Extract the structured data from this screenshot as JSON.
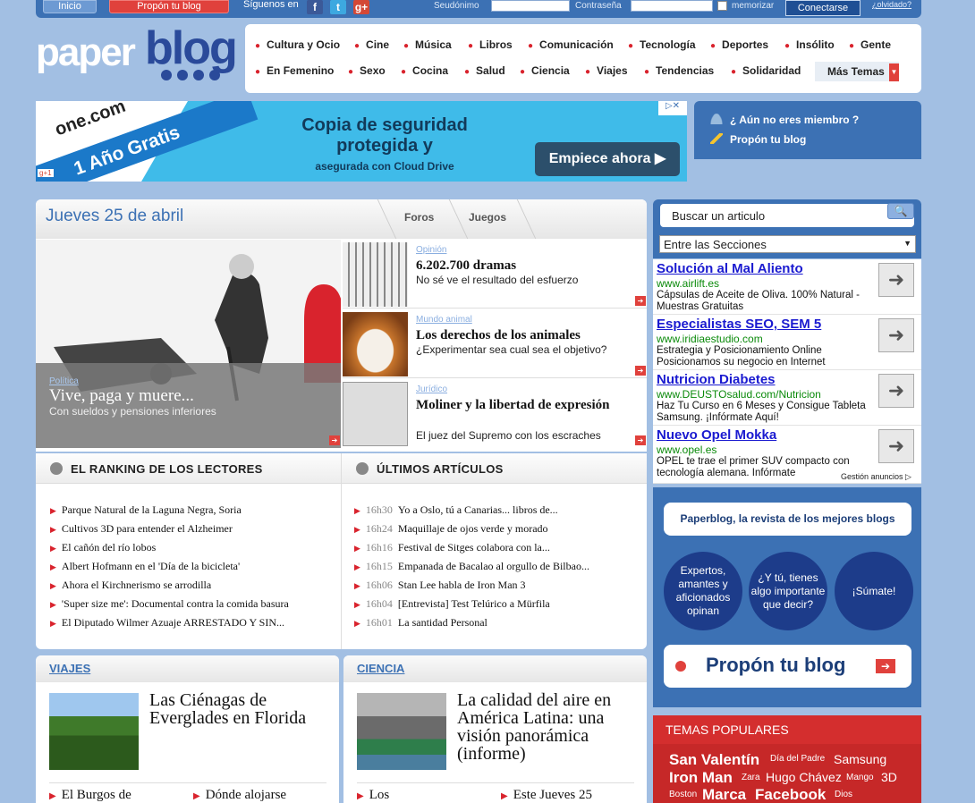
{
  "topbar": {
    "inicio": "Inicio",
    "propon": "Propón tu blog",
    "follow": "Síguenos en",
    "social": [
      "f",
      "t",
      "g+"
    ],
    "user_label": "Seudónimo",
    "pass_label": "Contraseña",
    "remember": "memorizar",
    "connect": "Conectarse",
    "forgot": "¿olvidado?"
  },
  "logo": {
    "paper": "paper",
    "blog": "blog"
  },
  "nav": {
    "row1": [
      "Cultura y Ocio",
      "Cine",
      "Música",
      "Libros",
      "Comunicación",
      "Tecnología",
      "Deportes",
      "Insólito",
      "Gente"
    ],
    "row2": [
      "En Femenino",
      "Sexo",
      "Cocina",
      "Salud",
      "Ciencia",
      "Viajes",
      "Tendencias",
      "Solidaridad"
    ],
    "more": "Más Temas"
  },
  "ad": {
    "brand": "one.com",
    "offer": "1 Año Gratis",
    "line1": "Copia de seguridad",
    "line2": "protegida y",
    "line3": "asegurada con Cloud Drive",
    "cta": "Empiece ahora ▶"
  },
  "member": {
    "q": "¿ Aún no eres miembro ?",
    "propon": "Propón tu blog"
  },
  "featured": {
    "date": "Jueves 25 de abril",
    "tabs": [
      "Foros",
      "Juegos"
    ],
    "hero": {
      "cat": "Política",
      "title": "Vive, paga y muere...",
      "sub": "Con sueldos y pensiones inferiores"
    },
    "articles": [
      {
        "cat": "Opinión",
        "title": "6.202.700 dramas",
        "sub": "No sé ve el resultado del esfuerzo"
      },
      {
        "cat": "Mundo animal",
        "title": "Los derechos de los animales",
        "sub": "¿Experimentar sea cual sea el objetivo?"
      },
      {
        "cat": "Jurídico",
        "title": "Moliner y la libertad de expresión",
        "sub": "El juez del Supremo con los escraches"
      }
    ]
  },
  "ranking": {
    "title": "EL RANKING DE LOS LECTORES",
    "items": [
      "Parque Natural de la Laguna Negra, Soria",
      "Cultivos 3D para entender el Alzheimer",
      "El cañón del río lobos",
      "Albert Hofmann en el 'Día de la bicicleta'",
      "Ahora el Kirchnerismo se arrodilla",
      "'Super size me': Documental contra la comida basura",
      "El Diputado Wilmer Azuaje ARRESTADO Y SIN..."
    ]
  },
  "latest": {
    "title": "ÚLTIMOS ARTÍCULOS",
    "items": [
      {
        "time": "16h30",
        "text": "Yo a Oslo, tú a Canarias... libros de..."
      },
      {
        "time": "16h24",
        "text": "Maquillaje de ojos verde y morado"
      },
      {
        "time": "16h16",
        "text": "Festival de Sitges colabora con la..."
      },
      {
        "time": "16h15",
        "text": "Empanada de Bacalao al orgullo de Bilbao..."
      },
      {
        "time": "16h06",
        "text": "Stan Lee habla de Iron Man 3"
      },
      {
        "time": "16h04",
        "text": "[Entrevista] Test Telúrico a Mürfila"
      },
      {
        "time": "16h01",
        "text": "La santidad Personal"
      }
    ]
  },
  "viajes": {
    "head": "VIAJES",
    "title": "Las Ciénagas de Everglades en Florida",
    "links": [
      "El Burgos de",
      "Dónde alojarse"
    ]
  },
  "ciencia": {
    "head": "CIENCIA",
    "title": "La calidad del aire en América Latina: una visión panorámica (informe)",
    "links": [
      "Los",
      "Este Jueves 25"
    ]
  },
  "search": {
    "placeholder": "Buscar un articulo",
    "sections": "Entre las Secciones"
  },
  "google_ads": [
    {
      "title": "Solución al Mal Aliento",
      "url": "www.airlift.es",
      "desc": "Cápsulas de Aceite de Oliva. 100% Natural - Muestras Gratuitas"
    },
    {
      "title": "Especialistas SEO, SEM 5",
      "url": "www.iridiaestudio.com",
      "desc": "Estrategia y Posicionamiento Online Posicionamos su negocio en Internet"
    },
    {
      "title": "Nutricion Diabetes",
      "url": "www.DEUSTOsalud.com/Nutricion",
      "desc": "Haz Tu Curso en 6 Meses y Consigue Tableta Samsung. ¡Infórmate Aquí!"
    },
    {
      "title": "Nuevo Opel Mokka",
      "url": "www.opel.es",
      "desc": "OPEL te trae el primer SUV compacto con tecnología alemana. Infórmate"
    }
  ],
  "ads_label": "Gestión anuncios ▷",
  "promo": {
    "top": "Paperblog, la revista de los mejores blogs",
    "c1": "Expertos, amantes y aficionados opinan",
    "c2": "¿Y tú, tienes algo importante que decir?",
    "c3": "¡Súmate!",
    "btn": "Propón tu blog"
  },
  "topics": {
    "head": "TEMAS POPULARES",
    "tags": [
      "San Valentín",
      "Día del Padre",
      "Samsung",
      "Iron Man",
      "Zara",
      "Hugo Chávez",
      "Mango",
      "3D",
      "Boston",
      "Marca",
      "Facebook",
      "Dios"
    ]
  },
  "colors": {
    "brand_blue": "#3c71b4",
    "accent_red": "#e0413c",
    "bg": "#a2bfe3"
  }
}
